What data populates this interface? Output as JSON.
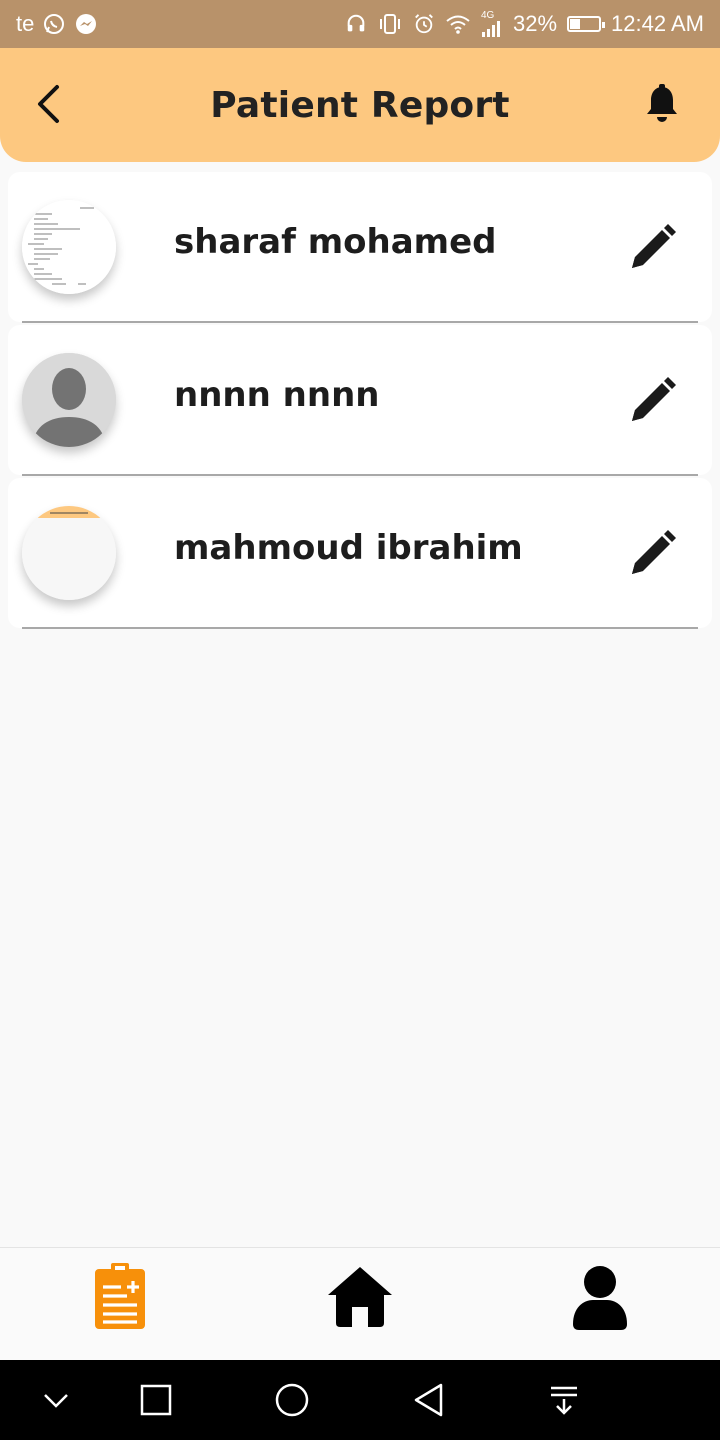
{
  "status_bar": {
    "carrier": "te",
    "network_type": "4G",
    "battery_percent": "32%",
    "battery_level": 0.32,
    "time": "12:42 AM",
    "icons": [
      "whatsapp-icon",
      "messenger-icon",
      "headset-icon",
      "vibrate-icon",
      "alarm-icon",
      "wifi-icon",
      "signal-icon",
      "battery-icon"
    ]
  },
  "header": {
    "title": "Patient Report",
    "back_icon": "chevron-left-icon",
    "notification_icon": "bell-icon",
    "background_color": "#fdc880"
  },
  "patients": [
    {
      "name": "sharaf mohamed",
      "avatar": "report-document-thumbnail",
      "action_icon": "pencil-icon"
    },
    {
      "name": "nnnn nnnn",
      "avatar": "default-person-silhouette",
      "action_icon": "pencil-icon"
    },
    {
      "name": "mahmoud ibrahim",
      "avatar": "report-document-thumbnail",
      "action_icon": "pencil-icon"
    }
  ],
  "bottom_nav": {
    "items": [
      {
        "id": "reports",
        "icon": "clipboard-icon",
        "active": true,
        "color": "#f7900a"
      },
      {
        "id": "home",
        "icon": "home-icon",
        "active": false,
        "color": "#000000"
      },
      {
        "id": "profile",
        "icon": "user-icon",
        "active": false,
        "color": "#000000"
      }
    ]
  },
  "system_nav": {
    "icons": [
      "chevron-down-icon",
      "square-icon",
      "circle-icon",
      "triangle-back-icon",
      "notification-pull-icon"
    ]
  }
}
